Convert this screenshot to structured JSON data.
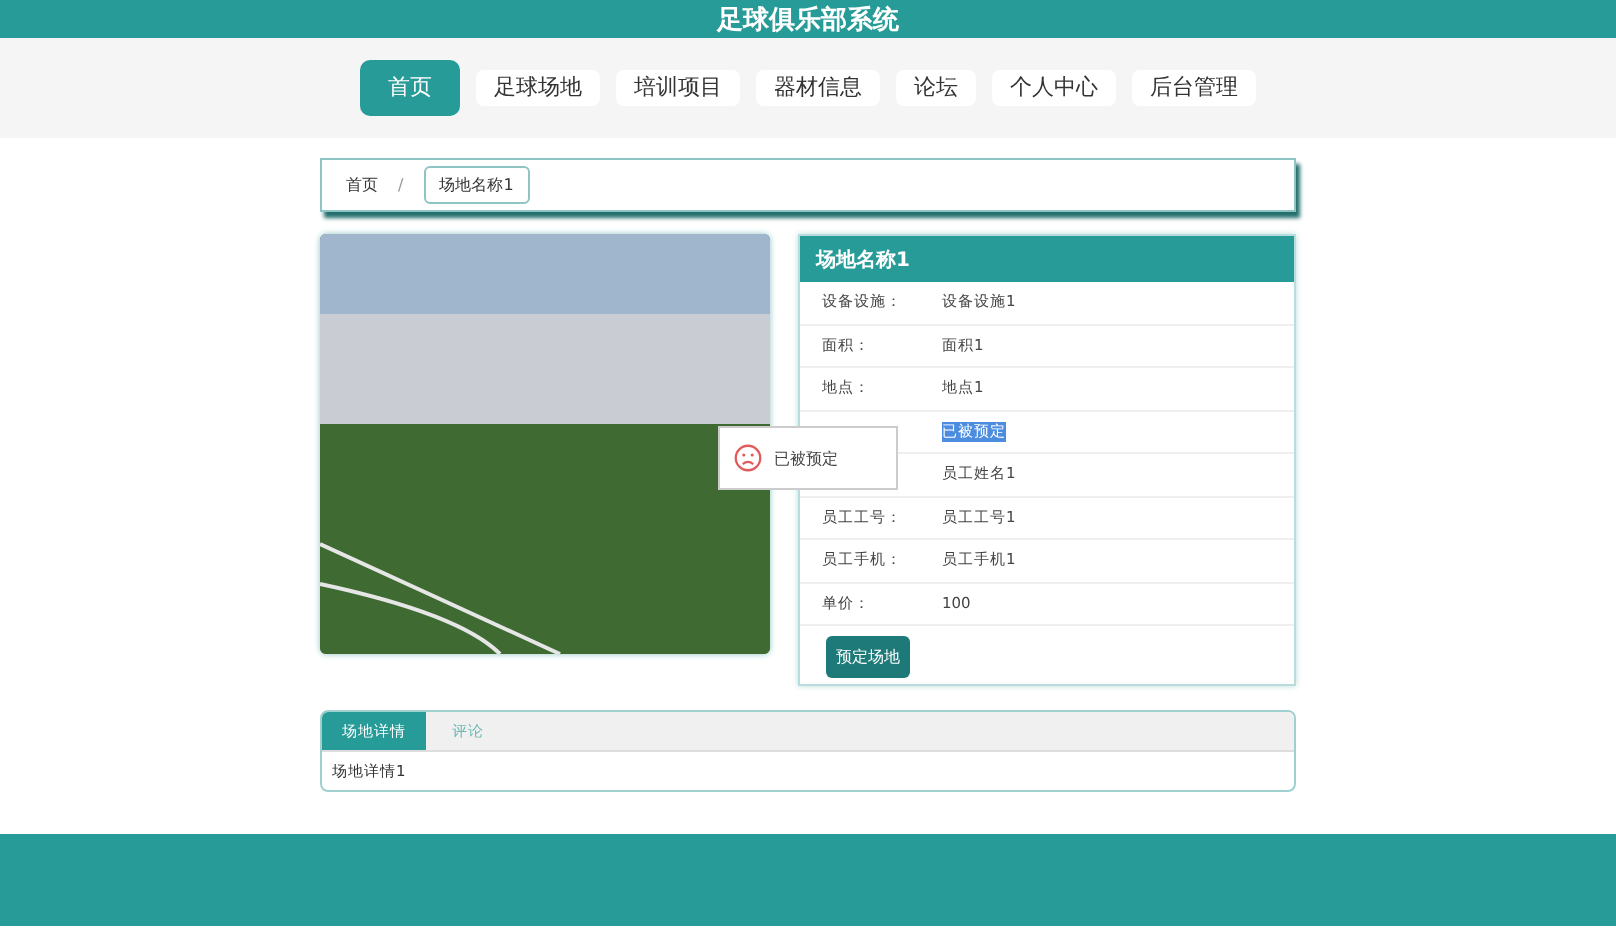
{
  "header": {
    "title": "足球俱乐部系统"
  },
  "nav": [
    {
      "label": "首页",
      "selected": true
    },
    {
      "label": "足球场地",
      "selected": false
    },
    {
      "label": "培训项目",
      "selected": false
    },
    {
      "label": "器材信息",
      "selected": false
    },
    {
      "label": "论坛",
      "selected": false
    },
    {
      "label": "个人中心",
      "selected": false
    },
    {
      "label": "后台管理",
      "selected": false
    }
  ],
  "breadcrumb": [
    {
      "label": "首页",
      "current": false
    },
    {
      "label": "场地名称1",
      "current": true
    }
  ],
  "breadcrumb_separator": "/",
  "details": {
    "title": "场地名称1",
    "rows": [
      {
        "label": "设备设施：",
        "value": "设备设施1",
        "highlighted": false
      },
      {
        "label": "面积：",
        "value": "面积1",
        "highlighted": false
      },
      {
        "label": "地点：",
        "value": "地点1",
        "highlighted": false
      },
      {
        "value": "已被预定",
        "highlighted": true
      },
      {
        "value": "员工姓名1",
        "highlighted": false
      },
      {
        "label": "员工工号：",
        "value": "员工工号1",
        "highlighted": false
      },
      {
        "label": "员工手机：",
        "value": "员工手机1",
        "highlighted": false
      },
      {
        "label": "单价：",
        "value": "100",
        "highlighted": false
      }
    ],
    "button": "预定场地"
  },
  "toast": {
    "text": "已被预定"
  },
  "tabs": [
    {
      "label": "场地详情",
      "selected": true
    },
    {
      "label": "评论",
      "selected": false
    }
  ],
  "tab_content": "场地详情1"
}
